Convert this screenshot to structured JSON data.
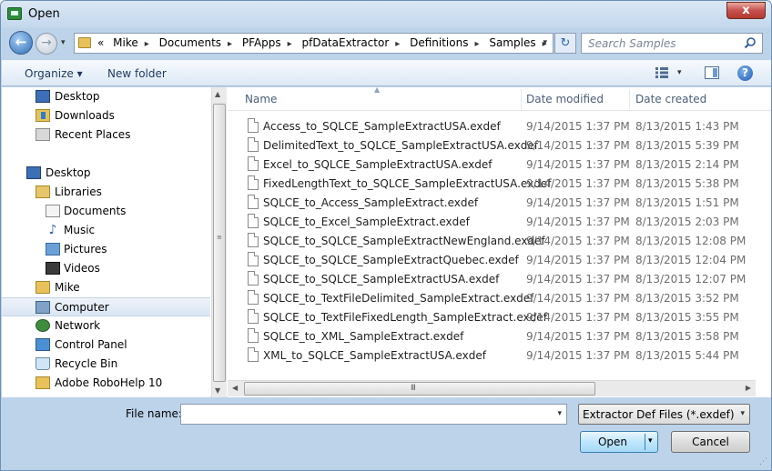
{
  "window": {
    "title": "Open",
    "close_glyph": "x"
  },
  "nav": {
    "back_glyph": "←",
    "forward_glyph": "→",
    "history_drop": "▾",
    "overflow": "«",
    "breadcrumbs": [
      "Mike",
      "Documents",
      "PFApps",
      "pfDataExtractor",
      "Definitions",
      "Samples"
    ],
    "separator": "▸",
    "address_drop": "▾",
    "refresh_glyph": "↻",
    "search_placeholder": "Search Samples"
  },
  "toolbar": {
    "organize_label": "Organize ▾",
    "new_folder_label": "New folder",
    "views_drop": "▾",
    "help_glyph": "?"
  },
  "sidebar": {
    "items": [
      {
        "label": "Desktop",
        "icon": "desktop-icon"
      },
      {
        "label": "Downloads",
        "icon": "downloads-icon"
      },
      {
        "label": "Recent Places",
        "icon": "recent-places-icon"
      },
      {
        "label": "Desktop",
        "icon": "desktop-icon"
      },
      {
        "label": "Libraries",
        "icon": "libraries-icon"
      },
      {
        "label": "Documents",
        "icon": "documents-icon"
      },
      {
        "label": "Music",
        "icon": "music-icon"
      },
      {
        "label": "Pictures",
        "icon": "pictures-icon"
      },
      {
        "label": "Videos",
        "icon": "videos-icon"
      },
      {
        "label": "Mike",
        "icon": "user-folder-icon"
      },
      {
        "label": "Computer",
        "icon": "computer-icon"
      },
      {
        "label": "Network",
        "icon": "network-icon"
      },
      {
        "label": "Control Panel",
        "icon": "control-panel-icon"
      },
      {
        "label": "Recycle Bin",
        "icon": "recycle-bin-icon"
      },
      {
        "label": "Adobe RoboHelp 10",
        "icon": "folder-icon"
      }
    ],
    "selected": "Computer",
    "music_glyph": "♪"
  },
  "filelist": {
    "columns": {
      "name": "Name",
      "modified": "Date modified",
      "created": "Date created"
    },
    "sort_glyph": "▲",
    "rows": [
      {
        "name": "Access_to_SQLCE_SampleExtractUSA.exdef",
        "modified": "9/14/2015 1:37 PM",
        "created": "8/13/2015 1:43 PM"
      },
      {
        "name": "DelimitedText_to_SQLCE_SampleExtractUSA.exdef",
        "modified": "9/14/2015 1:37 PM",
        "created": "8/13/2015 5:39 PM"
      },
      {
        "name": "Excel_to_SQLCE_SampleExtractUSA.exdef",
        "modified": "9/14/2015 1:37 PM",
        "created": "8/13/2015 2:14 PM"
      },
      {
        "name": "FixedLengthText_to_SQLCE_SampleExtractUSA.exdef",
        "modified": "9/14/2015 1:37 PM",
        "created": "8/13/2015 5:38 PM"
      },
      {
        "name": "SQLCE_to_Access_SampleExtract.exdef",
        "modified": "9/14/2015 1:37 PM",
        "created": "8/13/2015 1:51 PM"
      },
      {
        "name": "SQLCE_to_Excel_SampleExtract.exdef",
        "modified": "9/14/2015 1:37 PM",
        "created": "8/13/2015 2:03 PM"
      },
      {
        "name": "SQLCE_to_SQLCE_SampleExtractNewEngland.exdef",
        "modified": "9/14/2015 1:37 PM",
        "created": "8/13/2015 12:08 PM"
      },
      {
        "name": "SQLCE_to_SQLCE_SampleExtractQuebec.exdef",
        "modified": "9/14/2015 1:37 PM",
        "created": "8/13/2015 12:04 PM"
      },
      {
        "name": "SQLCE_to_SQLCE_SampleExtractUSA.exdef",
        "modified": "9/14/2015 1:37 PM",
        "created": "8/13/2015 12:07 PM"
      },
      {
        "name": "SQLCE_to_TextFileDelimited_SampleExtract.exdef",
        "modified": "9/14/2015 1:37 PM",
        "created": "8/13/2015 3:52 PM"
      },
      {
        "name": "SQLCE_to_TextFileFixedLength_SampleExtract.exdef",
        "modified": "9/14/2015 1:37 PM",
        "created": "8/13/2015 3:55 PM"
      },
      {
        "name": "SQLCE_to_XML_SampleExtract.exdef",
        "modified": "9/14/2015 1:37 PM",
        "created": "8/13/2015 3:58 PM"
      },
      {
        "name": "XML_to_SQLCE_SampleExtractUSA.exdef",
        "modified": "9/14/2015 1:37 PM",
        "created": "8/13/2015 5:44 PM"
      }
    ]
  },
  "scroll": {
    "up": "▲",
    "down": "▼",
    "left": "◀",
    "right": "▶",
    "grip_v": "≡",
    "grip_h": "III"
  },
  "footer": {
    "filename_label": "File name:",
    "filename_value": "",
    "filename_drop": "▾",
    "filter_value": "Extractor Def Files (*.exdef)",
    "filter_drop": "▾",
    "open_label": "Open",
    "open_drop": "▾",
    "cancel_label": "Cancel",
    "resize_grip": "⋰"
  }
}
